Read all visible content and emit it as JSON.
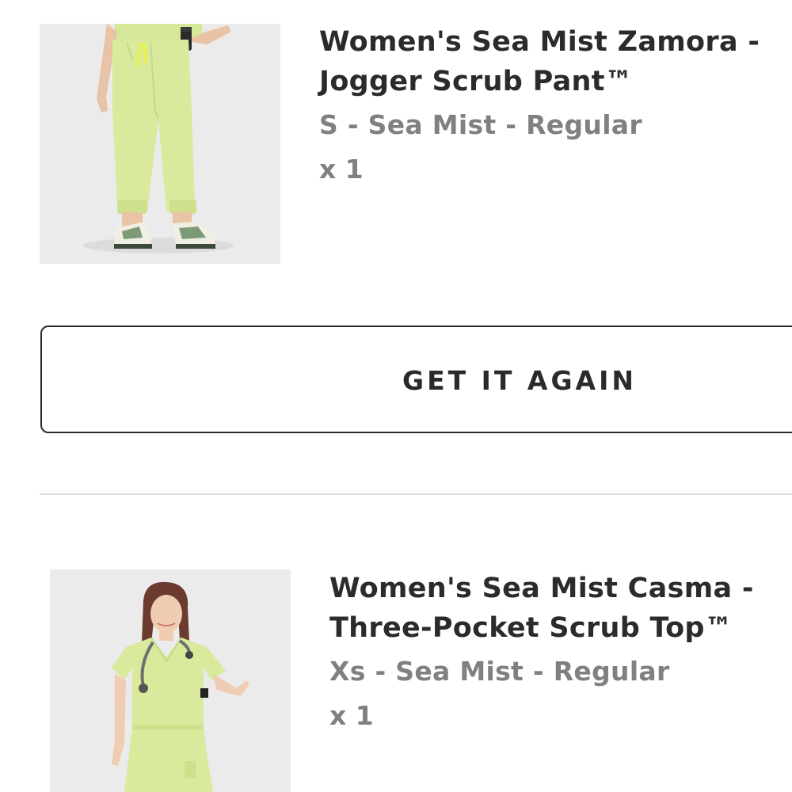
{
  "orders": [
    {
      "title_line1": "Women's Sea Mist Zamora -",
      "title_line2": "Jogger Scrub Pant™",
      "variant": "S - Sea Mist - Regular",
      "quantity": "x 1",
      "image_icon": "product-photo-jogger-pant"
    },
    {
      "title_line1": "Women's Sea Mist Casma -",
      "title_line2": "Three-Pocket Scrub Top™",
      "variant": "Xs - Sea Mist - Regular",
      "quantity": "x 1",
      "image_icon": "product-photo-scrub-top"
    }
  ],
  "actions": {
    "get_it_again_label": "GET IT AGAIN"
  },
  "colors": {
    "product_color": "#d9ea9c",
    "text_dark": "#2b2b2b",
    "text_muted": "#808080",
    "divider": "#dcdcdc"
  }
}
